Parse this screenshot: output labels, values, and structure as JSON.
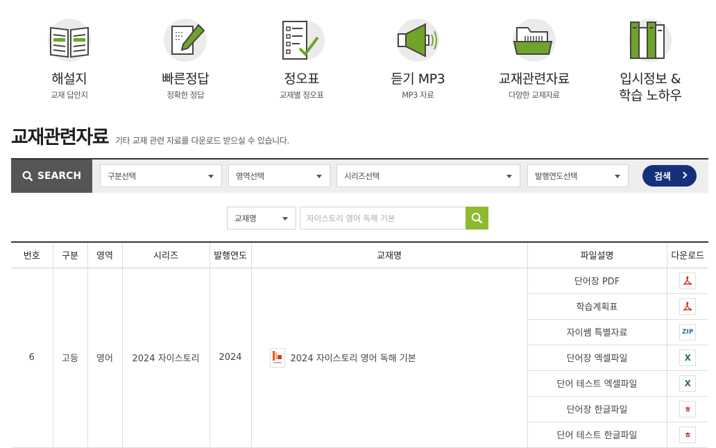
{
  "categories": [
    {
      "title": "해설지",
      "sub": "교재 답안지",
      "icon": "open-book-icon"
    },
    {
      "title": "빠른정답",
      "sub": "정확한 정답",
      "icon": "pencil-note-icon"
    },
    {
      "title": "정오표",
      "sub": "교재별 정오표",
      "icon": "checklist-icon"
    },
    {
      "title": "듣기 MP3",
      "sub": "MP3 자료",
      "icon": "speaker-icon"
    },
    {
      "title": "교재관련자료",
      "sub": "다양한 교재자료",
      "icon": "folder-icon"
    },
    {
      "title": "입시정보 &\n학습 노하우",
      "sub": "",
      "icon": "books-icon"
    }
  ],
  "page": {
    "title": "교재관련자료",
    "description": "기타 교재 관련 자료를 다운로드 받으실 수 있습니다."
  },
  "search": {
    "label": "SEARCH",
    "selects": [
      "구분선택",
      "영역선택",
      "시리즈선택",
      "발행연도선택"
    ],
    "submit_label": "검색",
    "keyword_type": "교재명",
    "keyword_placeholder": "자이스토리 영어 독해 기본"
  },
  "table": {
    "headers": [
      "번호",
      "구분",
      "영역",
      "시리즈",
      "발행연도",
      "교재명",
      "파일설명",
      "다운로드"
    ],
    "row": {
      "no": "6",
      "division": "고등",
      "subject": "영어",
      "series": "2024 자이스토리",
      "year": "2024",
      "book_name": "2024 자이스토리 영어 독해 기본"
    },
    "files": [
      {
        "desc": "단어장 PDF",
        "type": "pdf-icon"
      },
      {
        "desc": "학습계획표",
        "type": "pdf-icon"
      },
      {
        "desc": "자이쌤 특별자료",
        "type": "zip-icon"
      },
      {
        "desc": "단어장 엑셀파일",
        "type": "excel-icon"
      },
      {
        "desc": "단어 테스트 엑셀파일",
        "type": "excel-icon"
      },
      {
        "desc": "단어장 한글파일",
        "type": "hwp-icon"
      },
      {
        "desc": "단어 테스트 한글파일",
        "type": "hwp-icon"
      }
    ],
    "zip_label": "ZIP",
    "excel_label": "X",
    "hwp_label": "ㅎ"
  },
  "colors": {
    "accent_green": "#8dbb2e",
    "navy_button": "#15307a",
    "search_label_bg": "#555555"
  }
}
